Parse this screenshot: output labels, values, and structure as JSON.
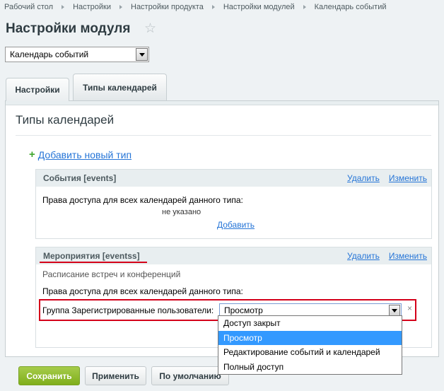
{
  "breadcrumb": [
    "Рабочий стол",
    "Настройки",
    "Настройки продукта",
    "Настройки модулей",
    "Календарь событий"
  ],
  "page_title": "Настройки модуля",
  "module_select": {
    "value": "Календарь событий"
  },
  "tabs": [
    {
      "label": "Настройки",
      "active": true
    },
    {
      "label": "Типы календарей",
      "active": false
    }
  ],
  "section_title": "Типы календарей",
  "add_type_label": "Добавить новый тип",
  "calendar_types": [
    {
      "name": "События [events]",
      "delete_label": "Удалить",
      "edit_label": "Изменить",
      "access_label": "Права доступа для всех календарей данного типа:",
      "not_set": "не указано",
      "add_label": "Добавить"
    },
    {
      "name": "Мероприятия [eventss]",
      "delete_label": "Удалить",
      "edit_label": "Изменить",
      "description": "Расписание встреч и конференций",
      "access_label": "Права доступа для всех календарей данного типа:",
      "group_label": "Группа Зарегистрированные пользователи:",
      "access_value": "Просмотр",
      "remove_symbol": "×"
    }
  ],
  "access_options": [
    "Доступ закрыт",
    "Просмотр",
    "Редактирование событий и календарей",
    "Полный доступ"
  ],
  "selected_option_index": 1,
  "buttons": {
    "save": "Сохранить",
    "apply": "Применить",
    "default": "По умолчанию"
  },
  "colors": {
    "link": "#2675d7",
    "save_button": "#8fbb2b",
    "highlight": "#d4001a",
    "selected_option": "#3399ff"
  }
}
